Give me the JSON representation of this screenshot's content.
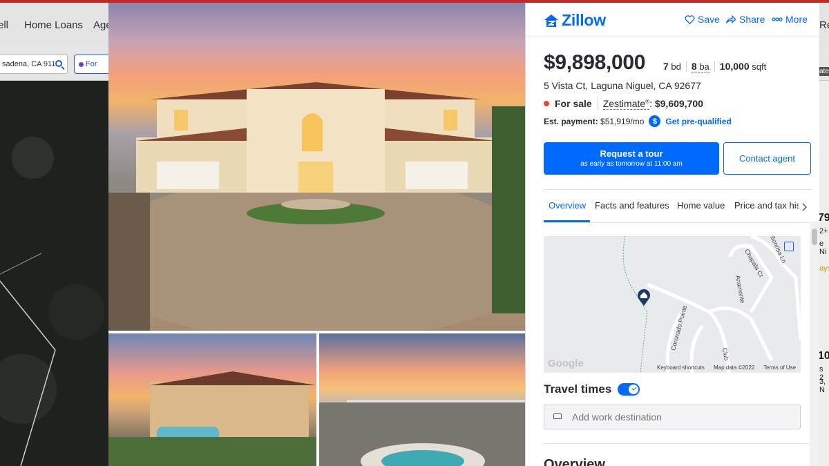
{
  "background": {
    "nav_items": [
      "ell",
      "Home Loans",
      "Age",
      "Re"
    ],
    "search_value": "sadena, CA 911",
    "filter_label": "For",
    "right_fragments": [
      "79",
      "2+",
      "e Ni",
      "ays",
      "10",
      "s 2",
      "3, N"
    ],
    "listing_fragment": "ate"
  },
  "header": {
    "brand": "Zillow",
    "save_label": "Save",
    "share_label": "Share",
    "more_label": "More"
  },
  "listing": {
    "price": "$9,898,000",
    "beds_value": "7",
    "beds_unit": "bd",
    "baths_value": "8",
    "baths_unit": "ba",
    "sqft_value": "10,000",
    "sqft_unit": "sqft",
    "address": "5 Vista Ct, Laguna Niguel, CA 92677",
    "status": "For sale",
    "zestimate_label": "Zestimate",
    "zestimate_mark": "®",
    "zestimate_value": "$9,609,700",
    "payment_label": "Est. payment:",
    "payment_value": "$51,919/mo",
    "prequal_label": "Get pre-qualified"
  },
  "actions": {
    "tour_title": "Request a tour",
    "tour_subtitle": "as early as tomorrow at 11:00 am",
    "contact_label": "Contact agent"
  },
  "tabs": [
    "Overview",
    "Facts and features",
    "Home value",
    "Price and tax history"
  ],
  "map": {
    "streets": [
      "Coronado Pointe",
      "Chapala Ct",
      "Anamonte",
      "Sonrisa Ln",
      "Club"
    ],
    "google": "Google",
    "keyboard_shortcuts": "Keyboard shortcuts",
    "map_data": "Map data ©2022",
    "terms": "Terms of Use"
  },
  "travel": {
    "title": "Travel times",
    "toggle_on": true,
    "placeholder": "Add work destination"
  },
  "section_heading": "Overview",
  "colors": {
    "brand_blue": "#006aff",
    "status_red": "#e8433a",
    "top_strip": "#c62828"
  }
}
